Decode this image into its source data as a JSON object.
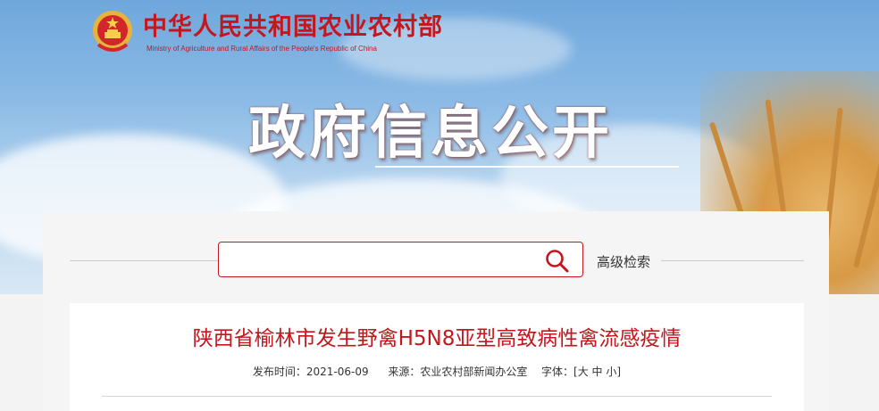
{
  "header": {
    "site_name": "中华人民共和国农业农村部",
    "site_name_en": "Ministry of Agriculture and Rural Affairs of the People's Republic of China",
    "section_title": "政府信息公开",
    "brand_color": "#c4161c"
  },
  "search": {
    "placeholder": "",
    "value": "",
    "icon": "search-icon",
    "advanced_label": "高级检索"
  },
  "article": {
    "title": "陕西省榆林市发生野禽H5N8亚型高致病性禽流感疫情",
    "published_label": "发布时间：",
    "published_date": "2021-06-09",
    "source_label": "来源：",
    "source": "农业农村部新闻办公室",
    "font_label": "字体：",
    "font_open": "[",
    "font_large": "大",
    "font_medium": "中",
    "font_small": "小",
    "font_close": "]"
  }
}
